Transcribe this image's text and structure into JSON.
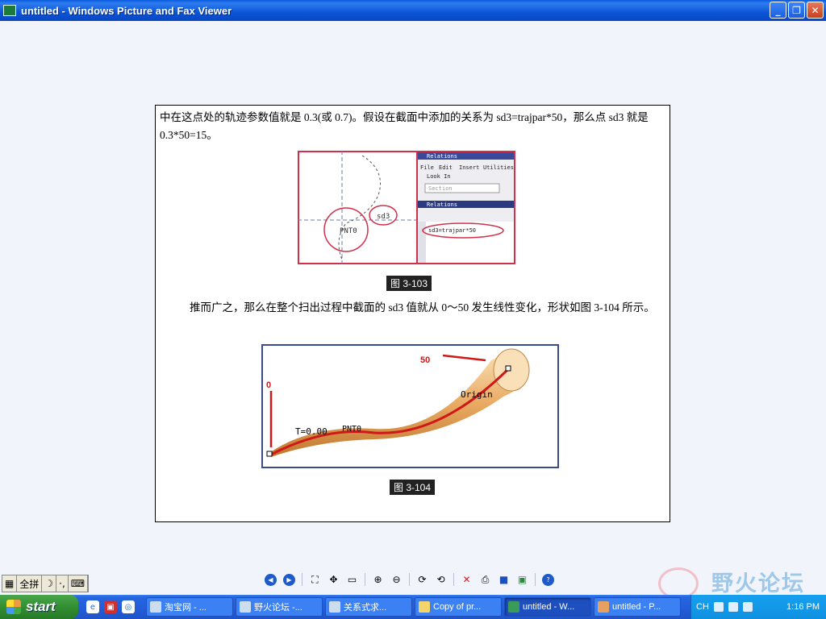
{
  "window": {
    "title": "untitled - Windows Picture and Fax Viewer"
  },
  "document": {
    "para1": "中在这点处的轨迹参数值就是 0.3(或 0.7)。假设在截面中添加的关系为 sd3=trajpar*50，那么点 sd3 就是 0.3*50=15。",
    "caption1": "图 3-103",
    "para2": "推而广之，那么在整个扫出过程中截面的 sd3 值就从 0～50 发生线性变化，形状如图 3-104 所示。",
    "caption2": "图 3-104",
    "fig1": {
      "dialog_title": "Relations",
      "menu": [
        "File",
        "Edit",
        "Insert",
        "Utilities"
      ],
      "look_in": "Look In",
      "section": "Section",
      "relations_header": "Relations",
      "relation_text": "sd3=trajpar*50",
      "dim_label": "sd3",
      "pnt_label": "PNT0"
    },
    "fig2": {
      "label_50": "50",
      "label_0": "0",
      "origin": "Origin",
      "t_value": "T=0.00",
      "pnt_label": "PNT0"
    }
  },
  "ime": {
    "mode": "全拼"
  },
  "watermark": {
    "text": "野火论坛"
  },
  "taskbar": {
    "start_label": "start",
    "tasks": [
      "淘宝网 - ...",
      "野火论坛 -...",
      "关系式求...",
      "Copy of pr...",
      "untitled - W...",
      "untitled - P..."
    ],
    "lang": "CH",
    "clock": "1:16 PM"
  }
}
